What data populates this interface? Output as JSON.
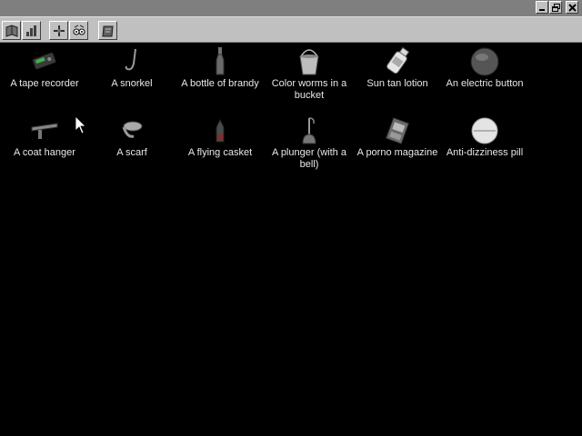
{
  "window": {
    "buttons": [
      {
        "name": "minimize",
        "icon": "minimize-icon"
      },
      {
        "name": "restore",
        "icon": "restore-icon"
      },
      {
        "name": "close",
        "icon": "close-icon"
      }
    ]
  },
  "toolbar": {
    "buttons": [
      {
        "icon": "inventory-book-icon"
      },
      {
        "icon": "chart-icon"
      },
      {
        "icon": "walk-action-icon"
      },
      {
        "icon": "talk-eyes-icon"
      },
      {
        "icon": "notebook-icon"
      }
    ]
  },
  "inventory": {
    "items": [
      {
        "label": "A tape recorder",
        "icon": "tape-recorder-icon"
      },
      {
        "label": "A snorkel",
        "icon": "snorkel-icon"
      },
      {
        "label": "A bottle of brandy",
        "icon": "brandy-bottle-icon"
      },
      {
        "label": "Color worms in a bucket",
        "icon": "bucket-icon"
      },
      {
        "label": "Sun tan lotion",
        "icon": "lotion-bottle-icon"
      },
      {
        "label": "An electric button",
        "icon": "electric-button-icon"
      },
      {
        "label": "A coat hanger",
        "icon": "coat-hanger-icon"
      },
      {
        "label": "A scarf",
        "icon": "scarf-icon"
      },
      {
        "label": "A flying casket",
        "icon": "flying-casket-icon"
      },
      {
        "label": "A plunger (with a bell)",
        "icon": "plunger-icon"
      },
      {
        "label": "A porno magazine",
        "icon": "magazine-icon"
      },
      {
        "label": "Anti-dizziness pill",
        "icon": "pill-icon"
      }
    ]
  },
  "colors": {
    "background": "#000000",
    "titlebar": "#7f7f7f",
    "toolbar": "#c0c0c0",
    "label_text": "#e8e8e8"
  }
}
